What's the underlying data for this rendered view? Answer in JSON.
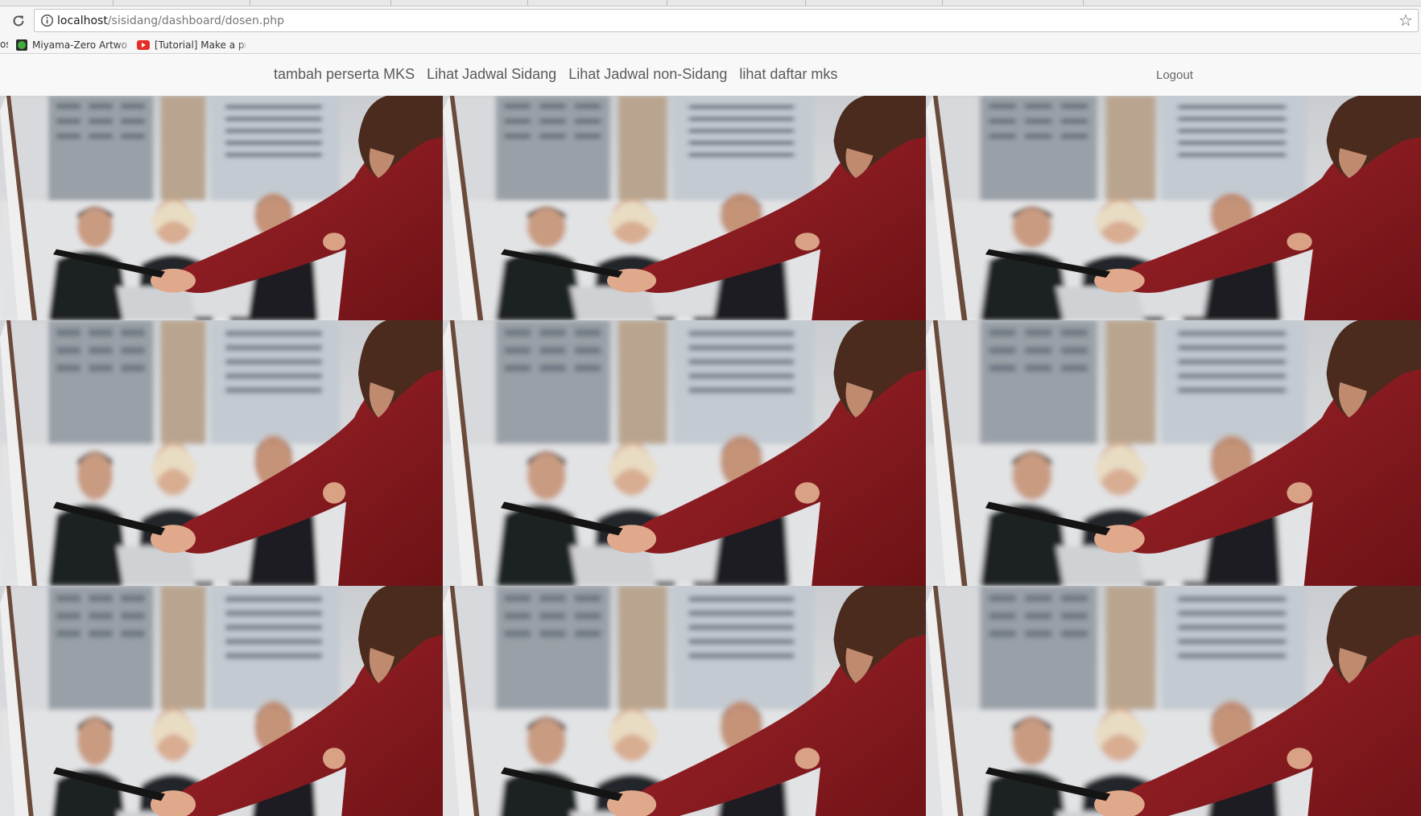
{
  "browser": {
    "url_host": "localhost",
    "url_path": "/sisidang/dashboard/dosen.php",
    "bookmarks_cut": "os",
    "bookmarks": [
      {
        "label": "Miyama-Zero Artwork",
        "icon": "green-circle-favicon"
      },
      {
        "label": "[Tutorial] Make a proj",
        "icon": "youtube-favicon"
      }
    ],
    "star_glyph": "☆"
  },
  "nav": {
    "links": [
      "tambah perserta MKS",
      "Lihat Jadwal Sidang",
      "Lihat Jadwal non-Sidang",
      "lihat daftar mks"
    ],
    "logout": "Logout"
  },
  "hero": {
    "image": "presentation-meeting-photo",
    "rows": 3,
    "columns": 3
  },
  "colors": {
    "nav_bg": "#f8f8f8",
    "nav_text": "#5a5a5a",
    "jacket_red": "#8b1a1c"
  }
}
